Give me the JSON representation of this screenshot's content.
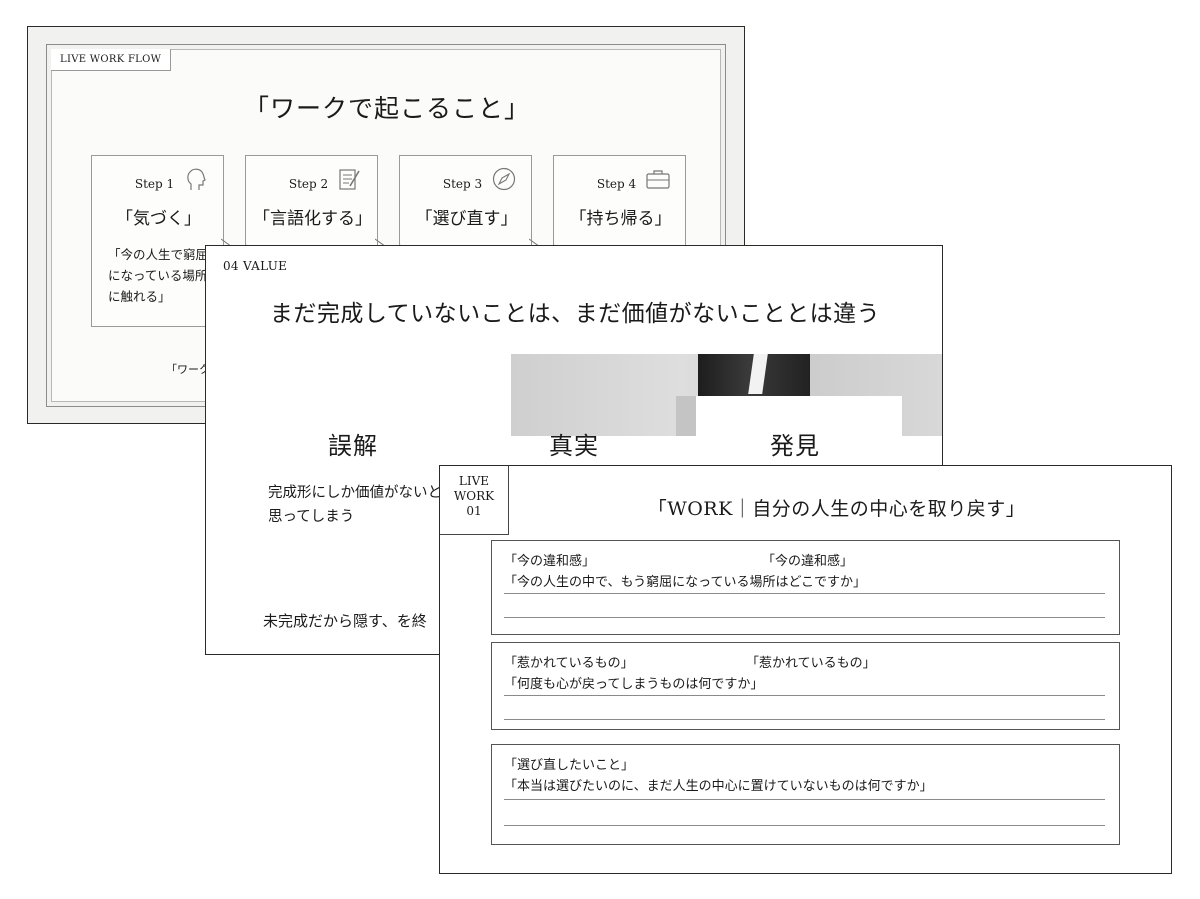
{
  "slide1": {
    "tag": "LIVE WORK FLOW",
    "title": "「ワークで起こること」",
    "steps": [
      {
        "label": "Step 1",
        "name": "「気づく」",
        "icon": "head-profile-icon",
        "desc": "「今の人生で窮屈になっている場所に触れる」"
      },
      {
        "label": "Step 2",
        "name": "「言語化する」",
        "icon": "notepad-pencil-icon",
        "desc": ""
      },
      {
        "label": "Step 3",
        "name": "「選び直す」",
        "icon": "compass-icon",
        "desc": ""
      },
      {
        "label": "Step 4",
        "name": "「持ち帰る」",
        "icon": "briefcase-icon",
        "desc": ""
      }
    ],
    "footnote": "「ワーク"
  },
  "slide2": {
    "section": "04  VALUE",
    "title": "まだ完成していないことは、まだ価値がないこととは違う",
    "columns": [
      {
        "head": "誤解",
        "desc": "完成形にしか価値がないと思ってしまう"
      },
      {
        "head": "真実"
      },
      {
        "head": "発見"
      }
    ],
    "bottom": "未完成だから隠す、を終"
  },
  "slide3": {
    "badge": [
      "LIVE",
      "WORK",
      "01"
    ],
    "title": "「WORK｜自分の人生の中心を取り戻す」",
    "boxes": [
      {
        "label": "「今の違和感」",
        "label_repeat": "「今の違和感」",
        "question": "「今の人生の中で、もう窮屈になっている場所はどこですか」"
      },
      {
        "label": "「惹かれているもの」",
        "label_repeat": "「惹かれているもの」",
        "question": "「何度も心が戻ってしまうものは何ですか」"
      },
      {
        "label": "「選び直したいこと」",
        "question": "「本当は選びたいのに、まだ人生の中心に置けていないものは何ですか」"
      }
    ]
  }
}
